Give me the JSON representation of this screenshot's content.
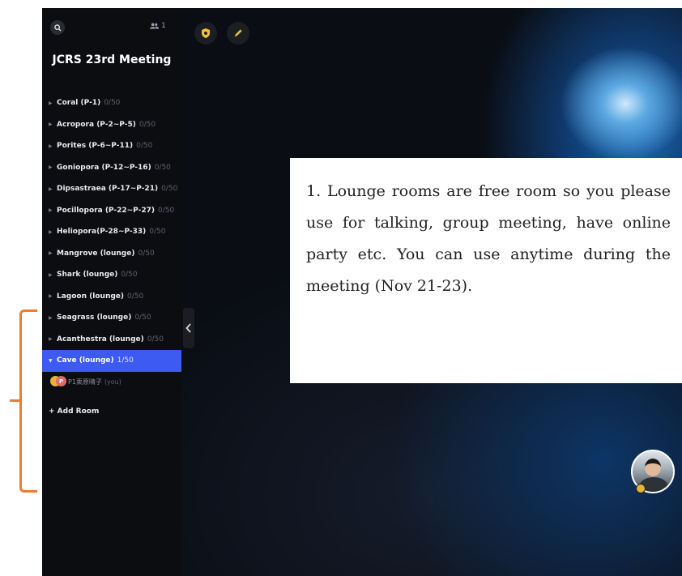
{
  "sidebar": {
    "title": "JCRS 23rd Meeting",
    "user_count": "1",
    "rooms": [
      {
        "label": "Coral (P-1)",
        "count": "0/50"
      },
      {
        "label": "Acropora (P-2~P-5)",
        "count": "0/50"
      },
      {
        "label": "Porites (P-6~P-11)",
        "count": "0/50"
      },
      {
        "label": "Goniopora (P-12~P-16)",
        "count": "0/50"
      },
      {
        "label": "Dipsastraea (P-17~P-21)",
        "count": "0/50"
      },
      {
        "label": "Pocillopora (P-22~P-27)",
        "count": "0/50"
      },
      {
        "label": "Heliopora(P-28~P-33)",
        "count": "0/50"
      },
      {
        "label": "Mangrove (lounge)",
        "count": "0/50"
      },
      {
        "label": "Shark (lounge)",
        "count": "0/50"
      },
      {
        "label": "Lagoon (lounge)",
        "count": "0/50"
      },
      {
        "label": "Seagrass (lounge)",
        "count": "0/50"
      },
      {
        "label": "Acanthestra (lounge)",
        "count": "0/50"
      },
      {
        "label": "Cave (lounge)",
        "count": "1/50"
      }
    ],
    "member": {
      "avatar_letter": "P",
      "name": "P1栗原晴子",
      "you_label": "(you)"
    },
    "add_room_label": "+ Add Room"
  },
  "note": {
    "text": "1. Lounge rooms are free room so you please use for talking, group meeting, have online party etc. You can use anytime during the meeting (Nov 21-23)."
  },
  "colors": {
    "active_room": "#3d5af1",
    "annotation": "#ee7b30",
    "badge": "#e9b236"
  },
  "icons": [
    "search-icon",
    "users-icon",
    "shield-icon",
    "pencil-icon",
    "chevron-left-icon"
  ]
}
